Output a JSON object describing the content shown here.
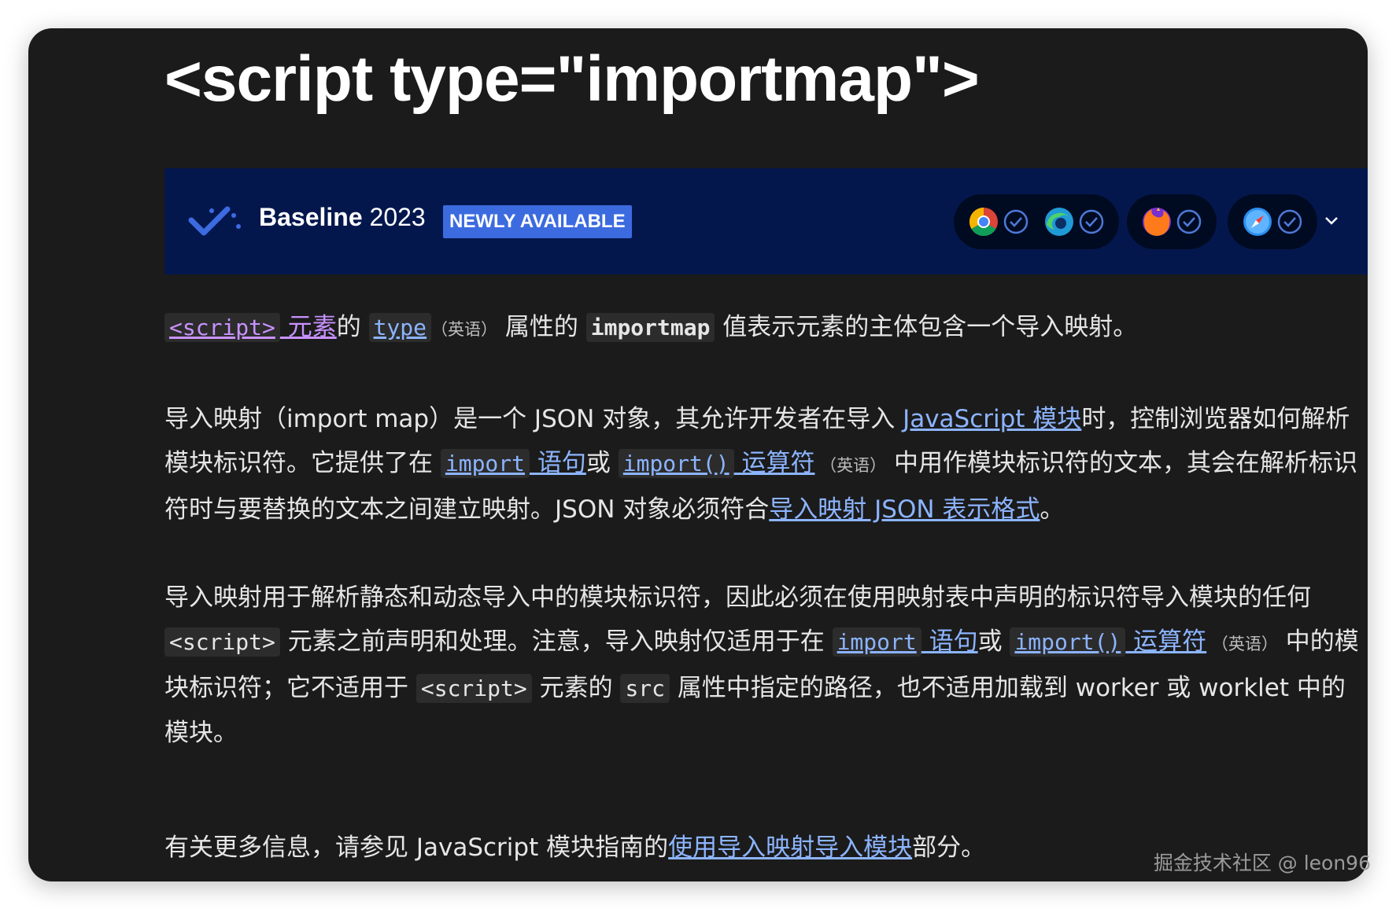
{
  "page": {
    "title": "<script type=\"importmap\">"
  },
  "baseline": {
    "label_bold": "Baseline",
    "label_year": "2023",
    "badge": "NEWLY AVAILABLE",
    "browsers": [
      {
        "icon": "chrome-icon",
        "status": "check-icon"
      },
      {
        "icon": "edge-icon",
        "status": "check-icon"
      },
      {
        "icon": "firefox-icon",
        "status": "check-icon"
      },
      {
        "icon": "safari-icon",
        "status": "check-icon"
      }
    ],
    "colors": {
      "background": "#04174d",
      "badge": "#3c6be0"
    }
  },
  "p1": {
    "script_tag": "<script>",
    "element": " 元素",
    "of": "的 ",
    "type": "type",
    "en": "（英语）",
    "attr_value_of": " 属性的 ",
    "importmap": "importmap",
    "rest": " 值表示元素的主体包含一个导入映射。"
  },
  "p2": {
    "t1": "导入映射（import map）是一个 JSON 对象，其允许开发者在导入 ",
    "link_js_modules": "JavaScript 模块",
    "t2": "时，控制浏览器如何解析模块标识符。它提供了在 ",
    "import_code": "import",
    "import_stmt": " 语句",
    "or": "或 ",
    "import_fn_code": "import()",
    "import_op": " 运算符",
    "en": " （英语）",
    "t3": " 中用作模块标识符的文本，其会在解析标识符时与要替换的文本之间建立映射。JSON 对象必须符合",
    "link_format": "导入映射 JSON 表示格式",
    "t4": "。"
  },
  "p3": {
    "t1": "导入映射用于解析静态和动态导入中的模块标识符，因此必须在使用映射表中声明的标识符导入模块的任何 ",
    "script_tag": "<script>",
    "t2": " 元素之前声明和处理。注意，导入映射仅适用于在 ",
    "import_code": "import",
    "import_stmt": " 语句",
    "or": "或 ",
    "import_fn_code": "import()",
    "import_op": " 运算符",
    "en": " （英语）",
    "t3": " 中的模块标识符；它不适用于 ",
    "script_tag2": "<script>",
    "t4": " 元素的 ",
    "src": "src",
    "t5": " 属性中指定的路径，也不适用加载到 worker 或 worklet 中的模块。"
  },
  "p4": {
    "t1": "有关更多信息，请参见 JavaScript 模块指南的",
    "link_guide": "使用导入映射导入模块",
    "t2": "部分。"
  },
  "watermark": "掘金技术社区 @ leon96"
}
